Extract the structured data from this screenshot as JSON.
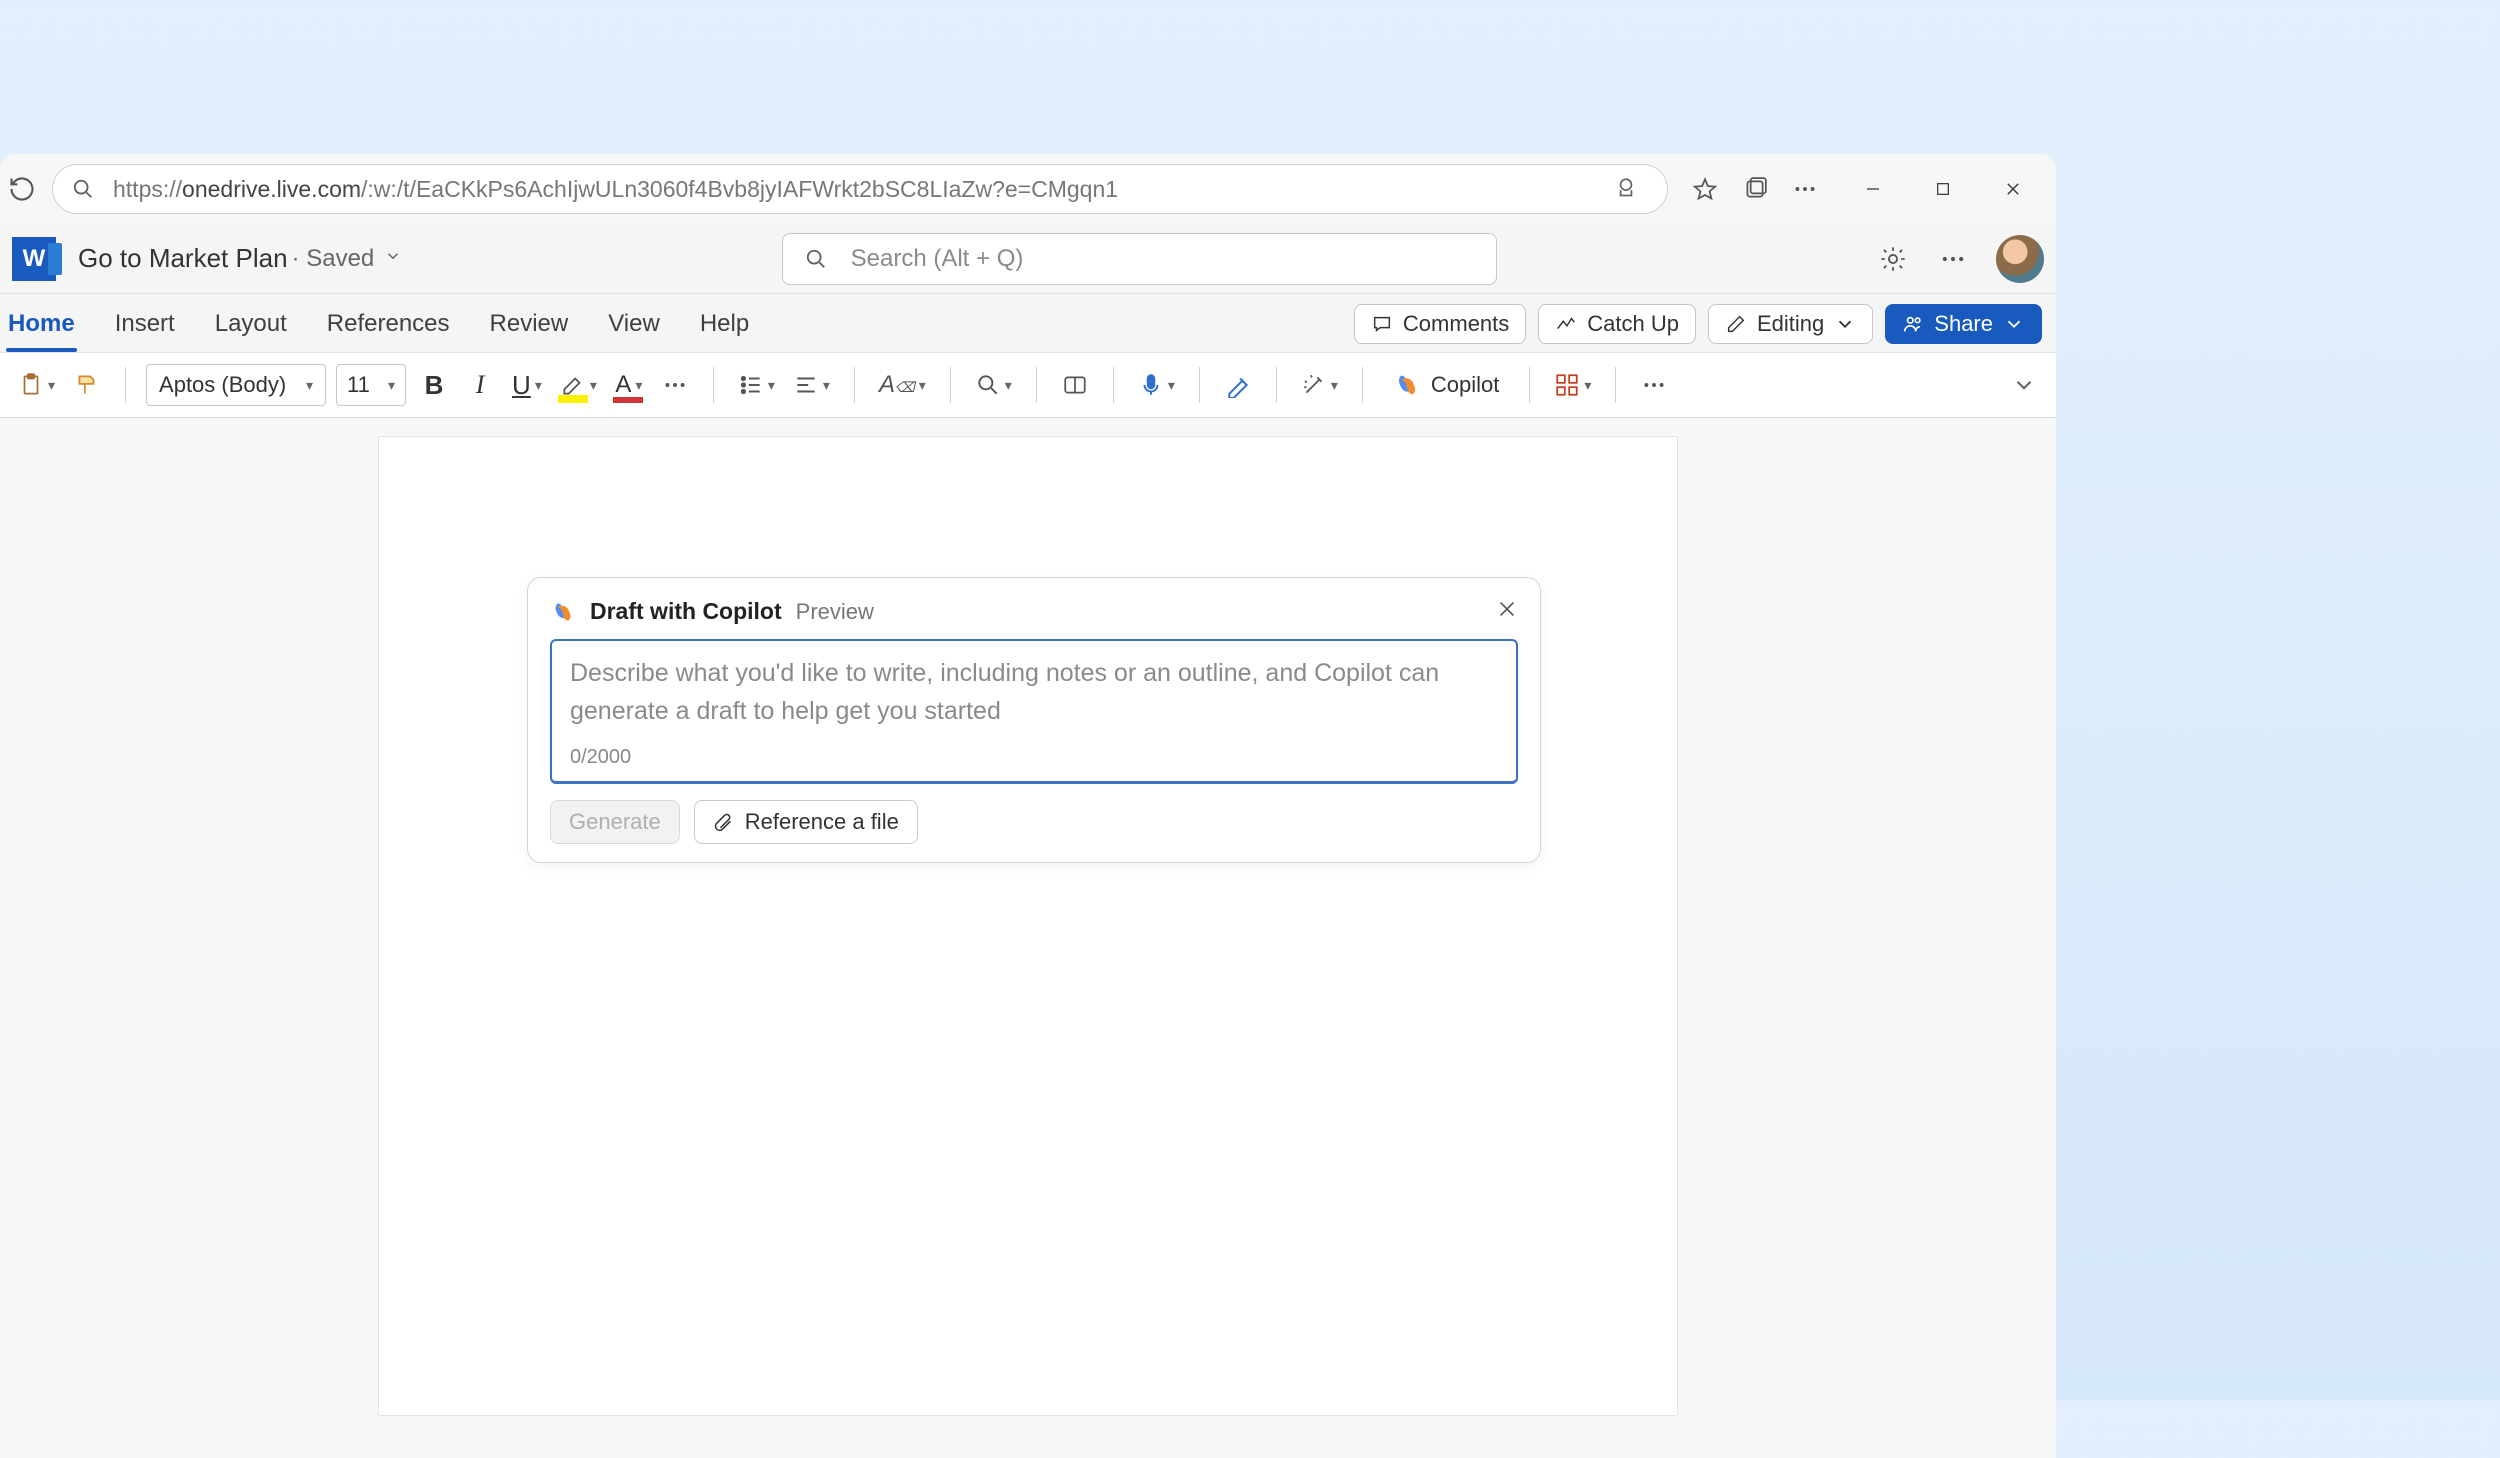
{
  "browser": {
    "url_prefix": "https://",
    "url_host": "onedrive.live.com",
    "url_path": "/:w:/t/EaCKkPs6AchIjwULn3060f4Bvb8jyIAFWrkt2bSC8LIaZw?e=CMgqn1"
  },
  "header": {
    "word_letter": "W",
    "doc_title": "Go to Market Plan",
    "saved_label": "· Saved",
    "search_placeholder": "Search (Alt + Q)"
  },
  "ribbon_tabs": {
    "items": [
      "Home",
      "Insert",
      "Layout",
      "References",
      "Review",
      "View",
      "Help"
    ],
    "active_index": 0
  },
  "actions": {
    "comments": "Comments",
    "catch_up": "Catch Up",
    "editing": "Editing",
    "share": "Share"
  },
  "toolbar": {
    "font_name": "Aptos (Body)",
    "font_size": "11",
    "copilot": "Copilot"
  },
  "draft_panel": {
    "title": "Draft with Copilot",
    "preview": "Preview",
    "placeholder": "Describe what you'd like to write, including notes or an outline, and Copilot can generate a draft to help get you started",
    "count": "0/2000",
    "generate": "Generate",
    "reference": "Reference a file"
  },
  "colors": {
    "accent": "#185ABD",
    "input_focus": "#3B72C4",
    "highlight": "#FFF200",
    "font_color": "#D13438"
  }
}
